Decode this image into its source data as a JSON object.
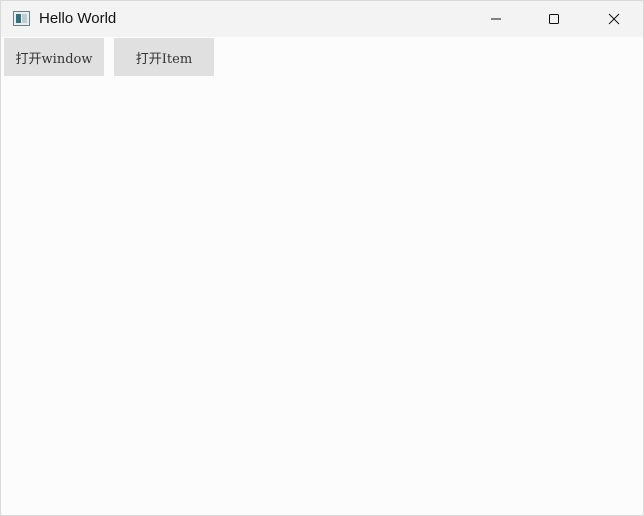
{
  "window": {
    "title": "Hello World"
  },
  "title_controls": {
    "minimize": "minimize-icon",
    "maximize": "maximize-icon",
    "close": "close-icon"
  },
  "toolbar": {
    "open_window_label": "打开window",
    "open_item_label": "打开Item"
  },
  "colors": {
    "titlebar_bg": "#f3f3f3",
    "button_bg": "#e0e0e0",
    "content_bg": "#fcfcfd"
  }
}
